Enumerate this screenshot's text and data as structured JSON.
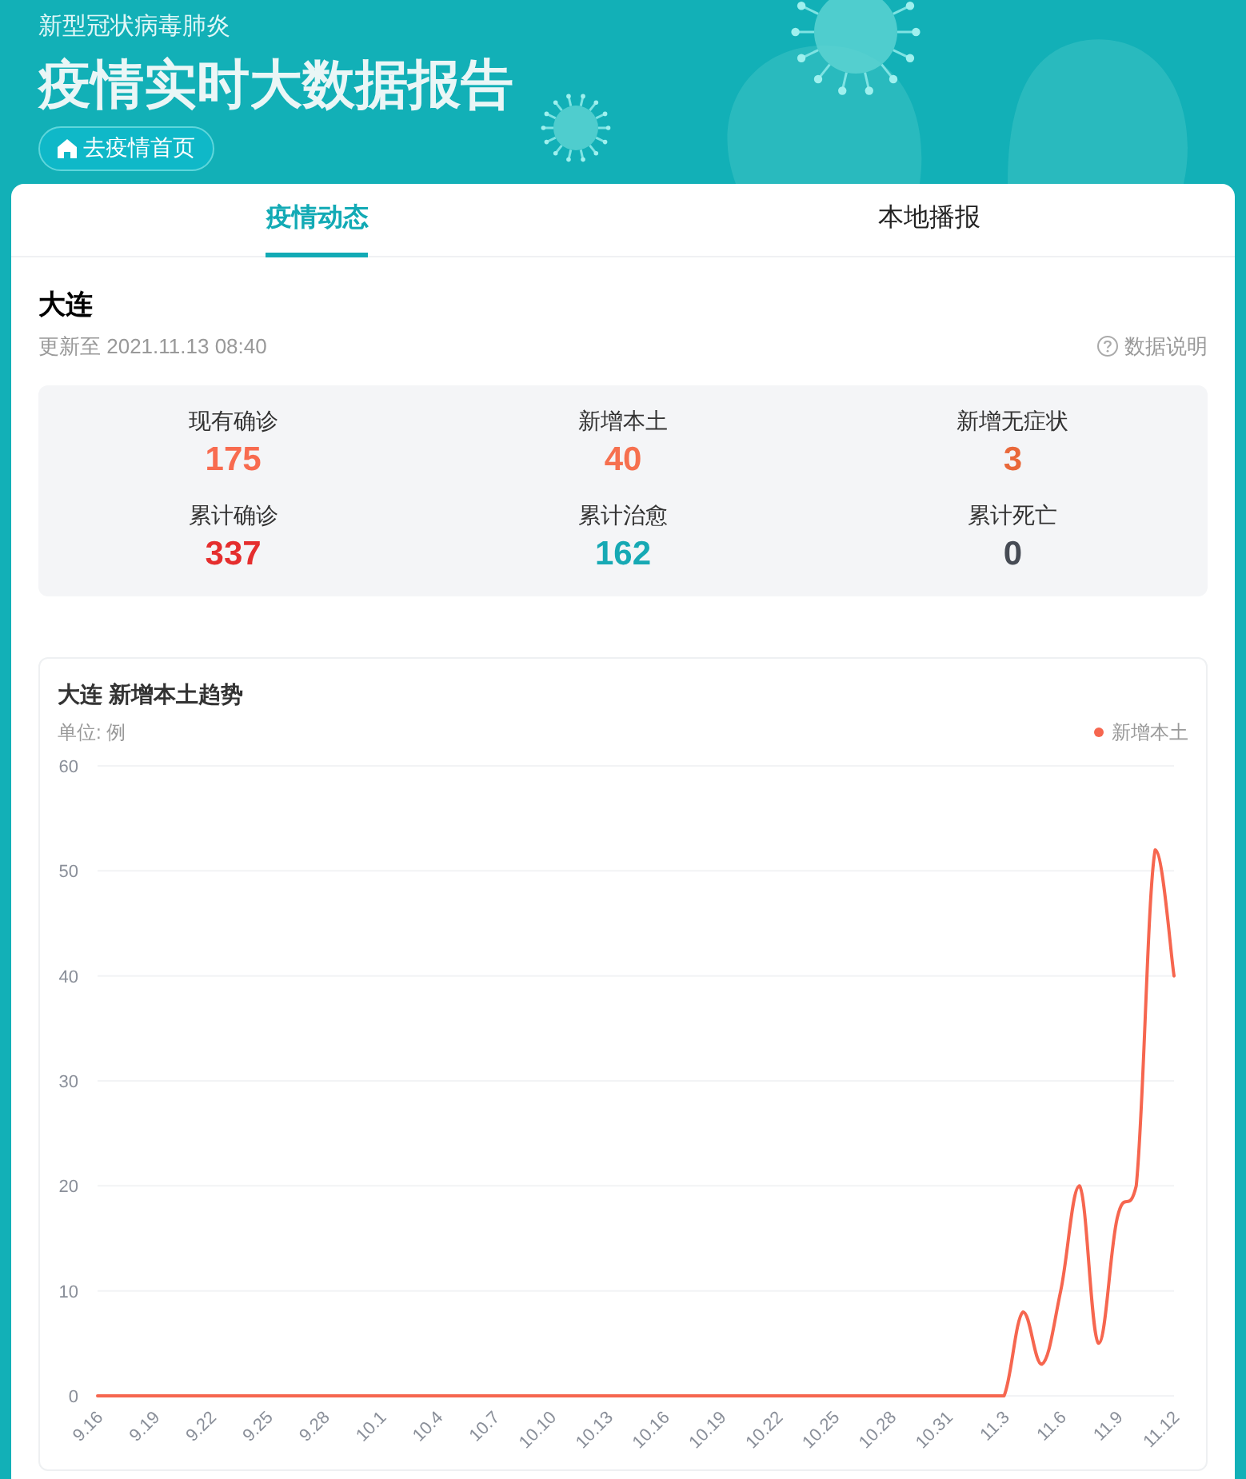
{
  "header": {
    "subtitle": "新型冠状病毒肺炎",
    "title": "疫情实时大数据报告",
    "home_button": "去疫情首页"
  },
  "tabs": [
    {
      "label": "疫情动态",
      "selected": true
    },
    {
      "label": "本地播报",
      "selected": false
    }
  ],
  "region": {
    "name": "大连",
    "updated": "更新至 2021.11.13 08:40",
    "info_link": "数据说明"
  },
  "stats": [
    {
      "label": "现有确诊",
      "value": "175",
      "color": "#f86b4f"
    },
    {
      "label": "新增本土",
      "value": "40",
      "color": "#f6704f"
    },
    {
      "label": "新增无症状",
      "value": "3",
      "color": "#e9683a"
    },
    {
      "label": "累计确诊",
      "value": "337",
      "color": "#e52e2e"
    },
    {
      "label": "累计治愈",
      "value": "162",
      "color": "#17a9b4"
    },
    {
      "label": "累计死亡",
      "value": "0",
      "color": "#474c55"
    }
  ],
  "trend": {
    "title": "大连 新增本土趋势",
    "unit": "单位: 例",
    "chart_data": {
      "type": "line",
      "categories": [
        "9.16",
        null,
        null,
        "9.19",
        null,
        null,
        "9.22",
        null,
        null,
        "9.25",
        null,
        null,
        "9.28",
        null,
        null,
        "10.1",
        null,
        null,
        "10.4",
        null,
        null,
        "10.7",
        null,
        null,
        "10.10",
        null,
        null,
        "10.13",
        null,
        null,
        "10.16",
        null,
        null,
        "10.19",
        null,
        null,
        "10.22",
        null,
        null,
        "10.25",
        null,
        null,
        "10.28",
        null,
        null,
        "10.31",
        null,
        null,
        "11.3",
        null,
        null,
        "11.6",
        null,
        null,
        "11.9",
        null,
        null,
        "11.12"
      ],
      "grid": true,
      "series": [
        {
          "name": "新增本土",
          "color": "#f6664f",
          "values": [
            0,
            0,
            0,
            0,
            0,
            0,
            0,
            0,
            0,
            0,
            0,
            0,
            0,
            0,
            0,
            0,
            0,
            0,
            0,
            0,
            0,
            0,
            0,
            0,
            0,
            0,
            0,
            0,
            0,
            0,
            0,
            0,
            0,
            0,
            0,
            0,
            0,
            0,
            0,
            0,
            0,
            0,
            0,
            0,
            0,
            0,
            0,
            0,
            0,
            8,
            3,
            10,
            20,
            5,
            17,
            20,
            52,
            40
          ]
        }
      ],
      "ylim": [
        0,
        60
      ],
      "yticks": [
        0,
        10,
        20,
        30,
        40,
        50,
        60
      ]
    }
  }
}
